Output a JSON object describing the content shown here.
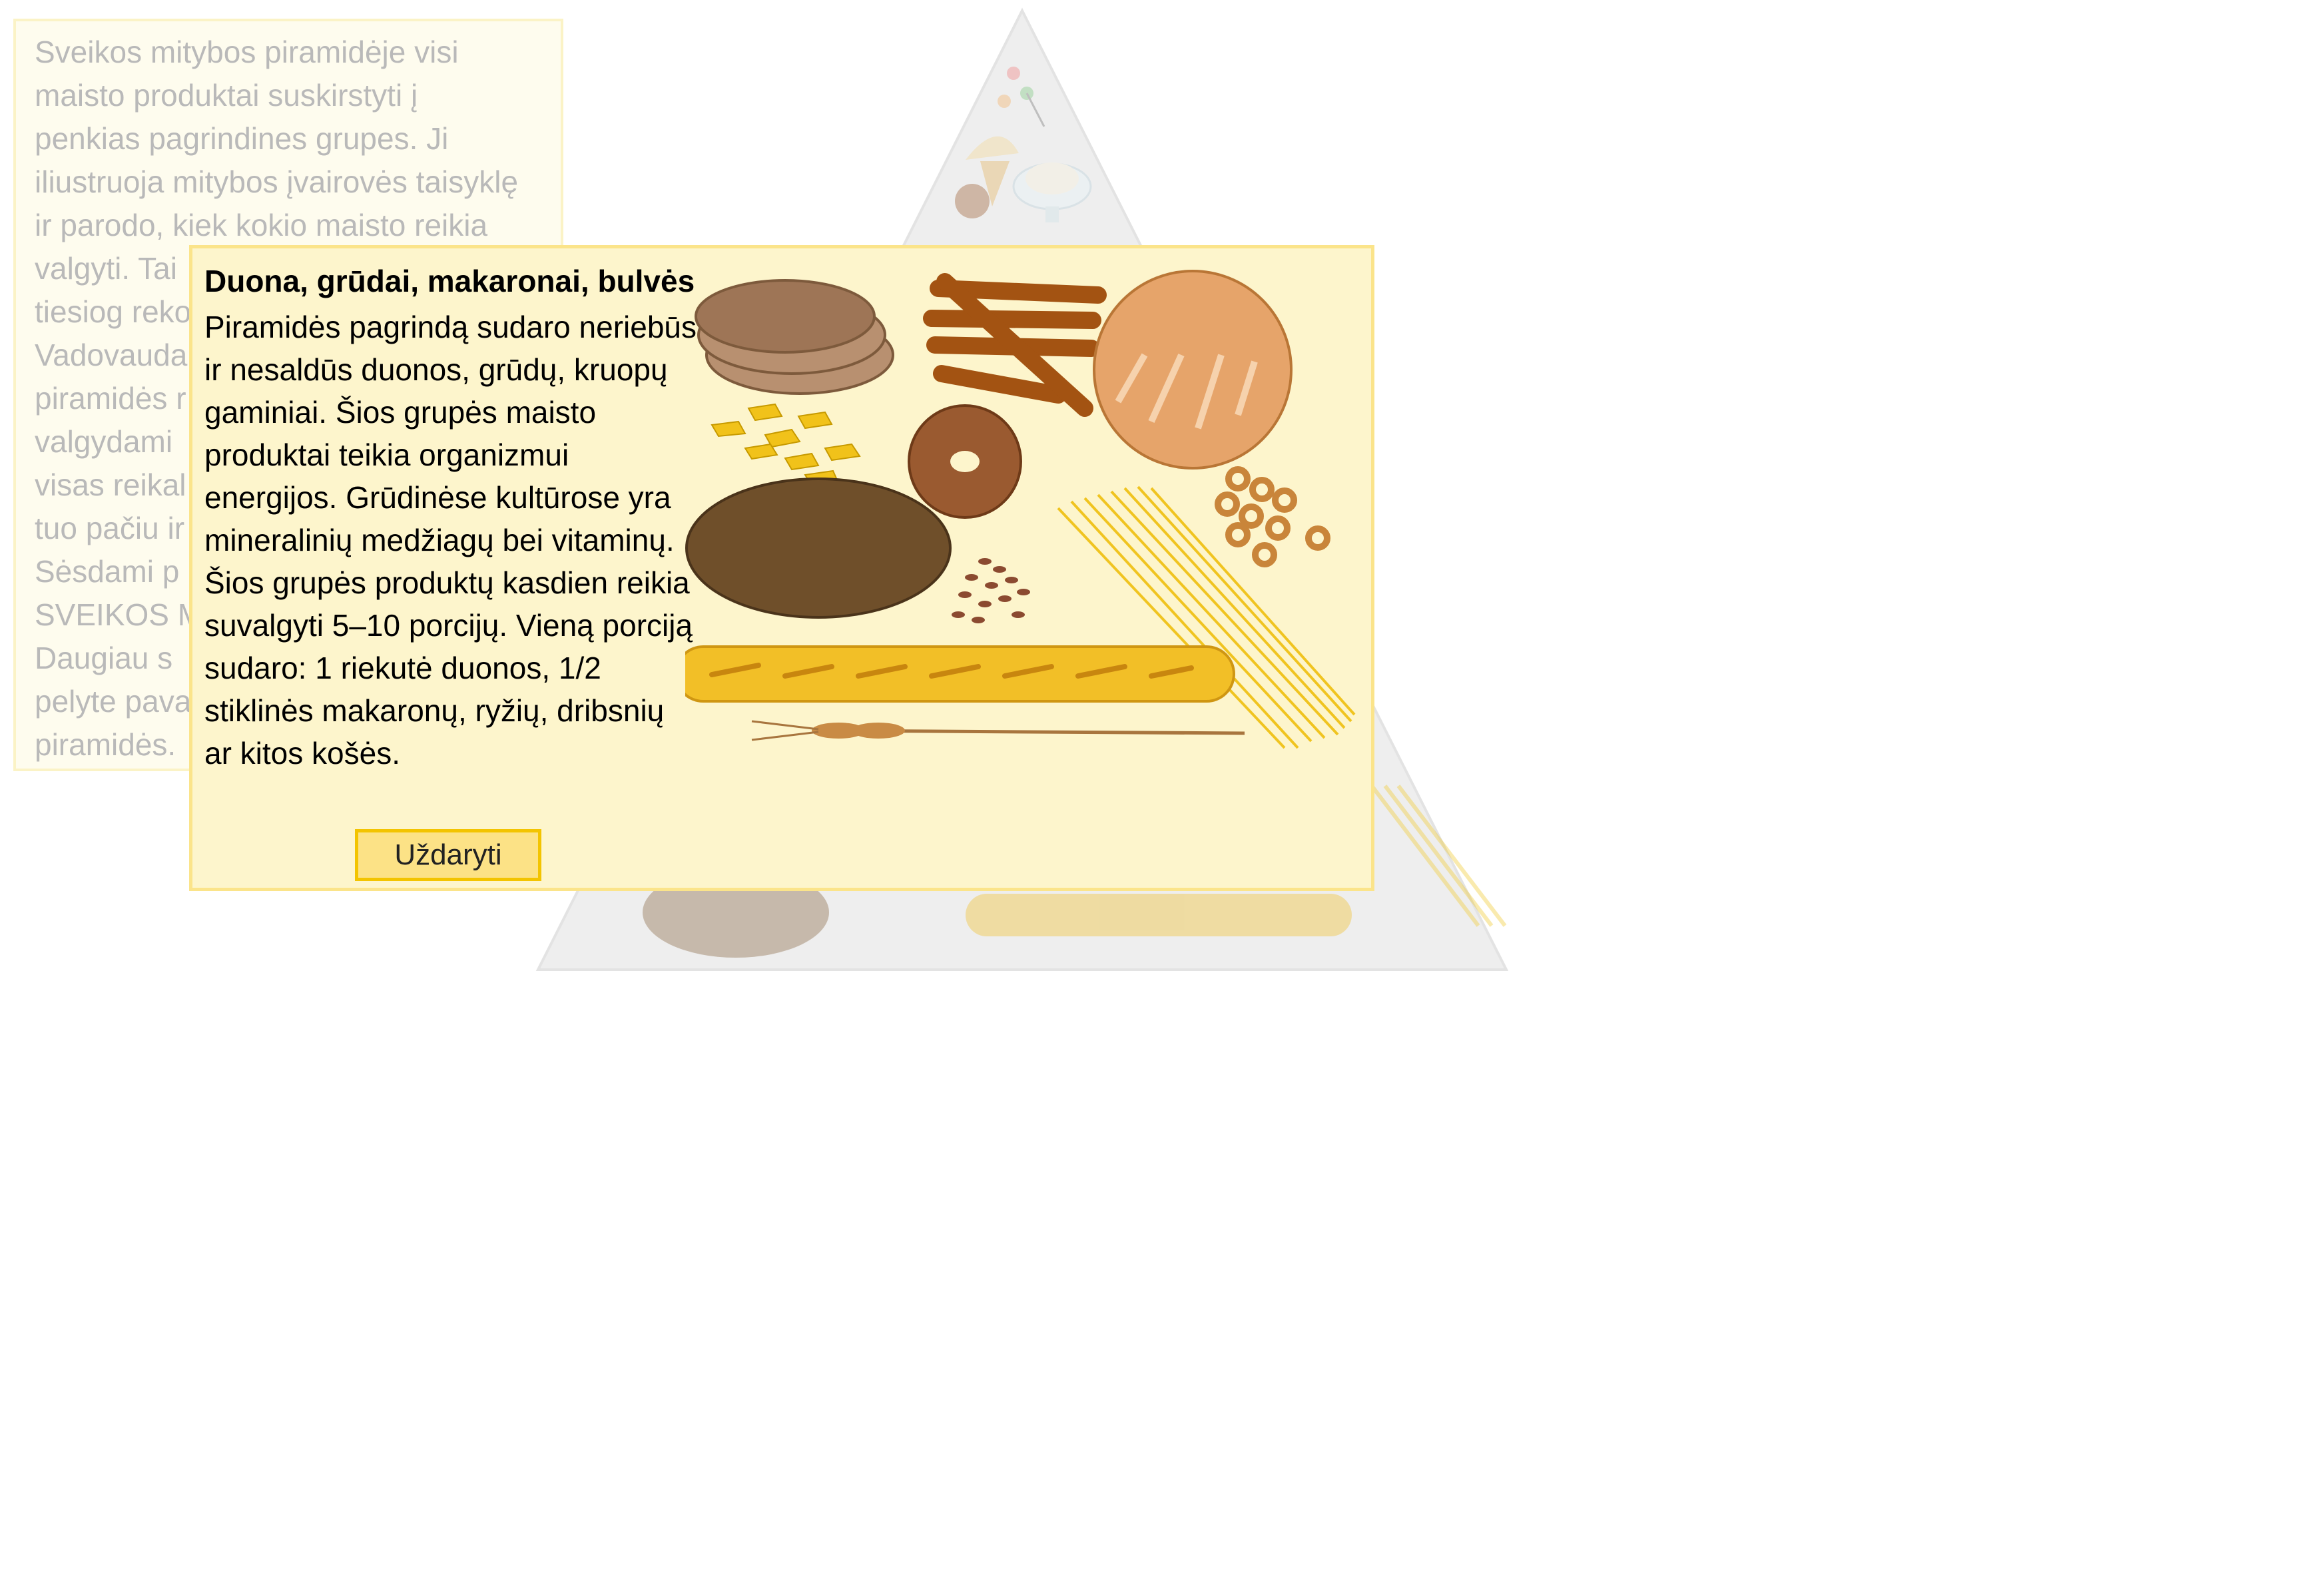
{
  "intro": {
    "text": "Sveikos mitybos piramidėje visi\nmaisto produktai suskirstyti į\npenkias pagrindines grupes. Ji\niliustruoja mitybos įvairovės taisyklę\nir parodo, kiek kokio maisto reikia\nvalgyti. Tai\ntiesiog reko\nVadovauda\npiramidės r\nvalgydami\nvisas reikal\ntuo pačiu ir\nSėsdami p\nSVEIKOS M\nDaugiau  s\npelyte pava\npiramidės."
  },
  "popup": {
    "title": "Duona, grūdai, makaronai, bulvės",
    "body": "Piramidės pagrindą sudaro neriebūs ir nesaldūs duonos, grūdų, kruopų gaminiai. Šios grupės maisto produktai teikia organizmui energijos. Grūdinėse kultūrose yra mineralinių medžiagų bei vitaminų. Šios grupės produktų kasdien reikia suvalgyti 5–10 porcijų. Vieną porciją sudaro: 1 riekutė duonos, 1/2 stiklinės makaronų, ryžių, dribsnių ar kitos košės.",
    "close_label": "Uždaryti"
  },
  "colors": {
    "popup_bg": "#fdf5cc",
    "popup_border": "#fbe48a",
    "button_bg": "#fce286",
    "button_border": "#f3c400",
    "intro_bg": "#fefcee",
    "intro_text": "#b9b9b9",
    "pyramid_fill": "#eeeeee"
  },
  "icons": [
    "bread-slices-icon",
    "breadsticks-icon",
    "round-loaf-icon",
    "pasta-penne-icon",
    "bagel-icon",
    "rye-loaf-icon",
    "cereal-rings-icon",
    "grains-icon",
    "spaghetti-icon",
    "baguette-icon",
    "wheat-ear-icon",
    "ice-cream-icon",
    "sweets-icon"
  ]
}
